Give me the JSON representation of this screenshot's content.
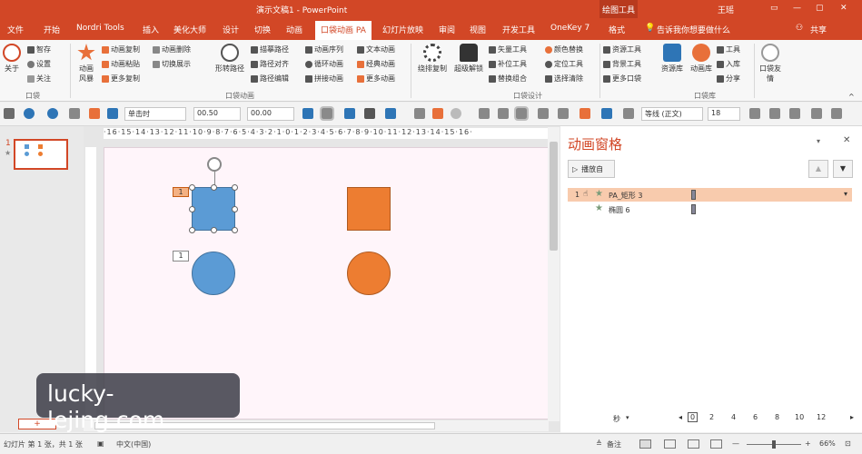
{
  "title": {
    "doc": "演示文稿1 - PowerPoint",
    "context_group": "绘图工具",
    "user": "王瑶",
    "share": "共享",
    "tell_me": "告诉我你想要做什么"
  },
  "tabs": [
    "文件",
    "开始",
    "Nordri Tools",
    "插入",
    "美化大师",
    "设计",
    "切换",
    "动画",
    "口袋动画 PA",
    "幻灯片放映",
    "审阅",
    "视图",
    "开发工具",
    "OneKey 7",
    "格式"
  ],
  "active_tab": "口袋动画 PA",
  "ribbon": {
    "about": "关于",
    "smart": "智存",
    "settings": "设置",
    "focus": "关注",
    "group_pocket": "口袋",
    "anim_style": "动画\n风暴",
    "anim_copy": "动画复制",
    "anim_paste": "动画粘贴",
    "more_copy": "更多复制",
    "anim_delete": "动画删除",
    "switch_show": "切换展示",
    "shape_path": "形转路径",
    "paint_path": "描摹路径",
    "path_align": "路径对齐",
    "path_edit": "路径编辑",
    "anim_seq": "动画序列",
    "loop_anim": "循环动画",
    "combine_anim": "拼接动画",
    "text_anim": "文本动画",
    "classic_anim": "经典动画",
    "more_anim": "更多动画",
    "group_anim": "口袋动画",
    "wrap_copy": "绕排复制",
    "super_unlock": "超级解锁",
    "vector_tool": "矢量工具",
    "patch_tool": "补位工具",
    "replace_combo": "替换组合",
    "color_replace": "颜色替换",
    "locate_tool": "定位工具",
    "select_clear": "选择清除",
    "group_design": "口袋设计",
    "resource_tool": "资源工具",
    "bg_tool": "背景工具",
    "more_pocket": "更多口袋",
    "resource_lib": "资源库",
    "anim_lib": "动画库",
    "tools": "工具",
    "import": "入库",
    "share": "分享",
    "pocket_friend": "口袋友\n情",
    "group_lib": "口袋库"
  },
  "toolbar": {
    "start_mode": "单击时",
    "duration": "00.50",
    "delay": "00.00",
    "font": "等线 (正文)",
    "font_size": "18"
  },
  "ruler_text": "·16·15·14·13·12·11·10·9·8·7·6·5·4·3·2·1·0·1·2·3·4·5·6·7·8·9·10·11·12·13·14·15·16·",
  "thumbs": {
    "number": "1",
    "star": "★",
    "add": "+"
  },
  "slide": {
    "tag1": "1",
    "tag2": "1"
  },
  "anim_pane": {
    "title": "动画窗格",
    "play_from": "播放自",
    "items": [
      {
        "num": "1",
        "name": "PA_矩形 3"
      },
      {
        "num": "",
        "name": "椭圆 6"
      }
    ],
    "seconds": "秒",
    "timeline": [
      "0",
      "2",
      "4",
      "6",
      "8",
      "10",
      "12"
    ]
  },
  "status": {
    "slide_info": "幻灯片 第 1 张，共 1 张",
    "lang": "中文(中国)",
    "notes": "备注",
    "zoom": "66%"
  },
  "watermark": "lucky-lejing.com",
  "colors": {
    "accent": "#d24726",
    "blue_shape": "#5b9bd5",
    "orange_shape": "#ed7d31"
  }
}
